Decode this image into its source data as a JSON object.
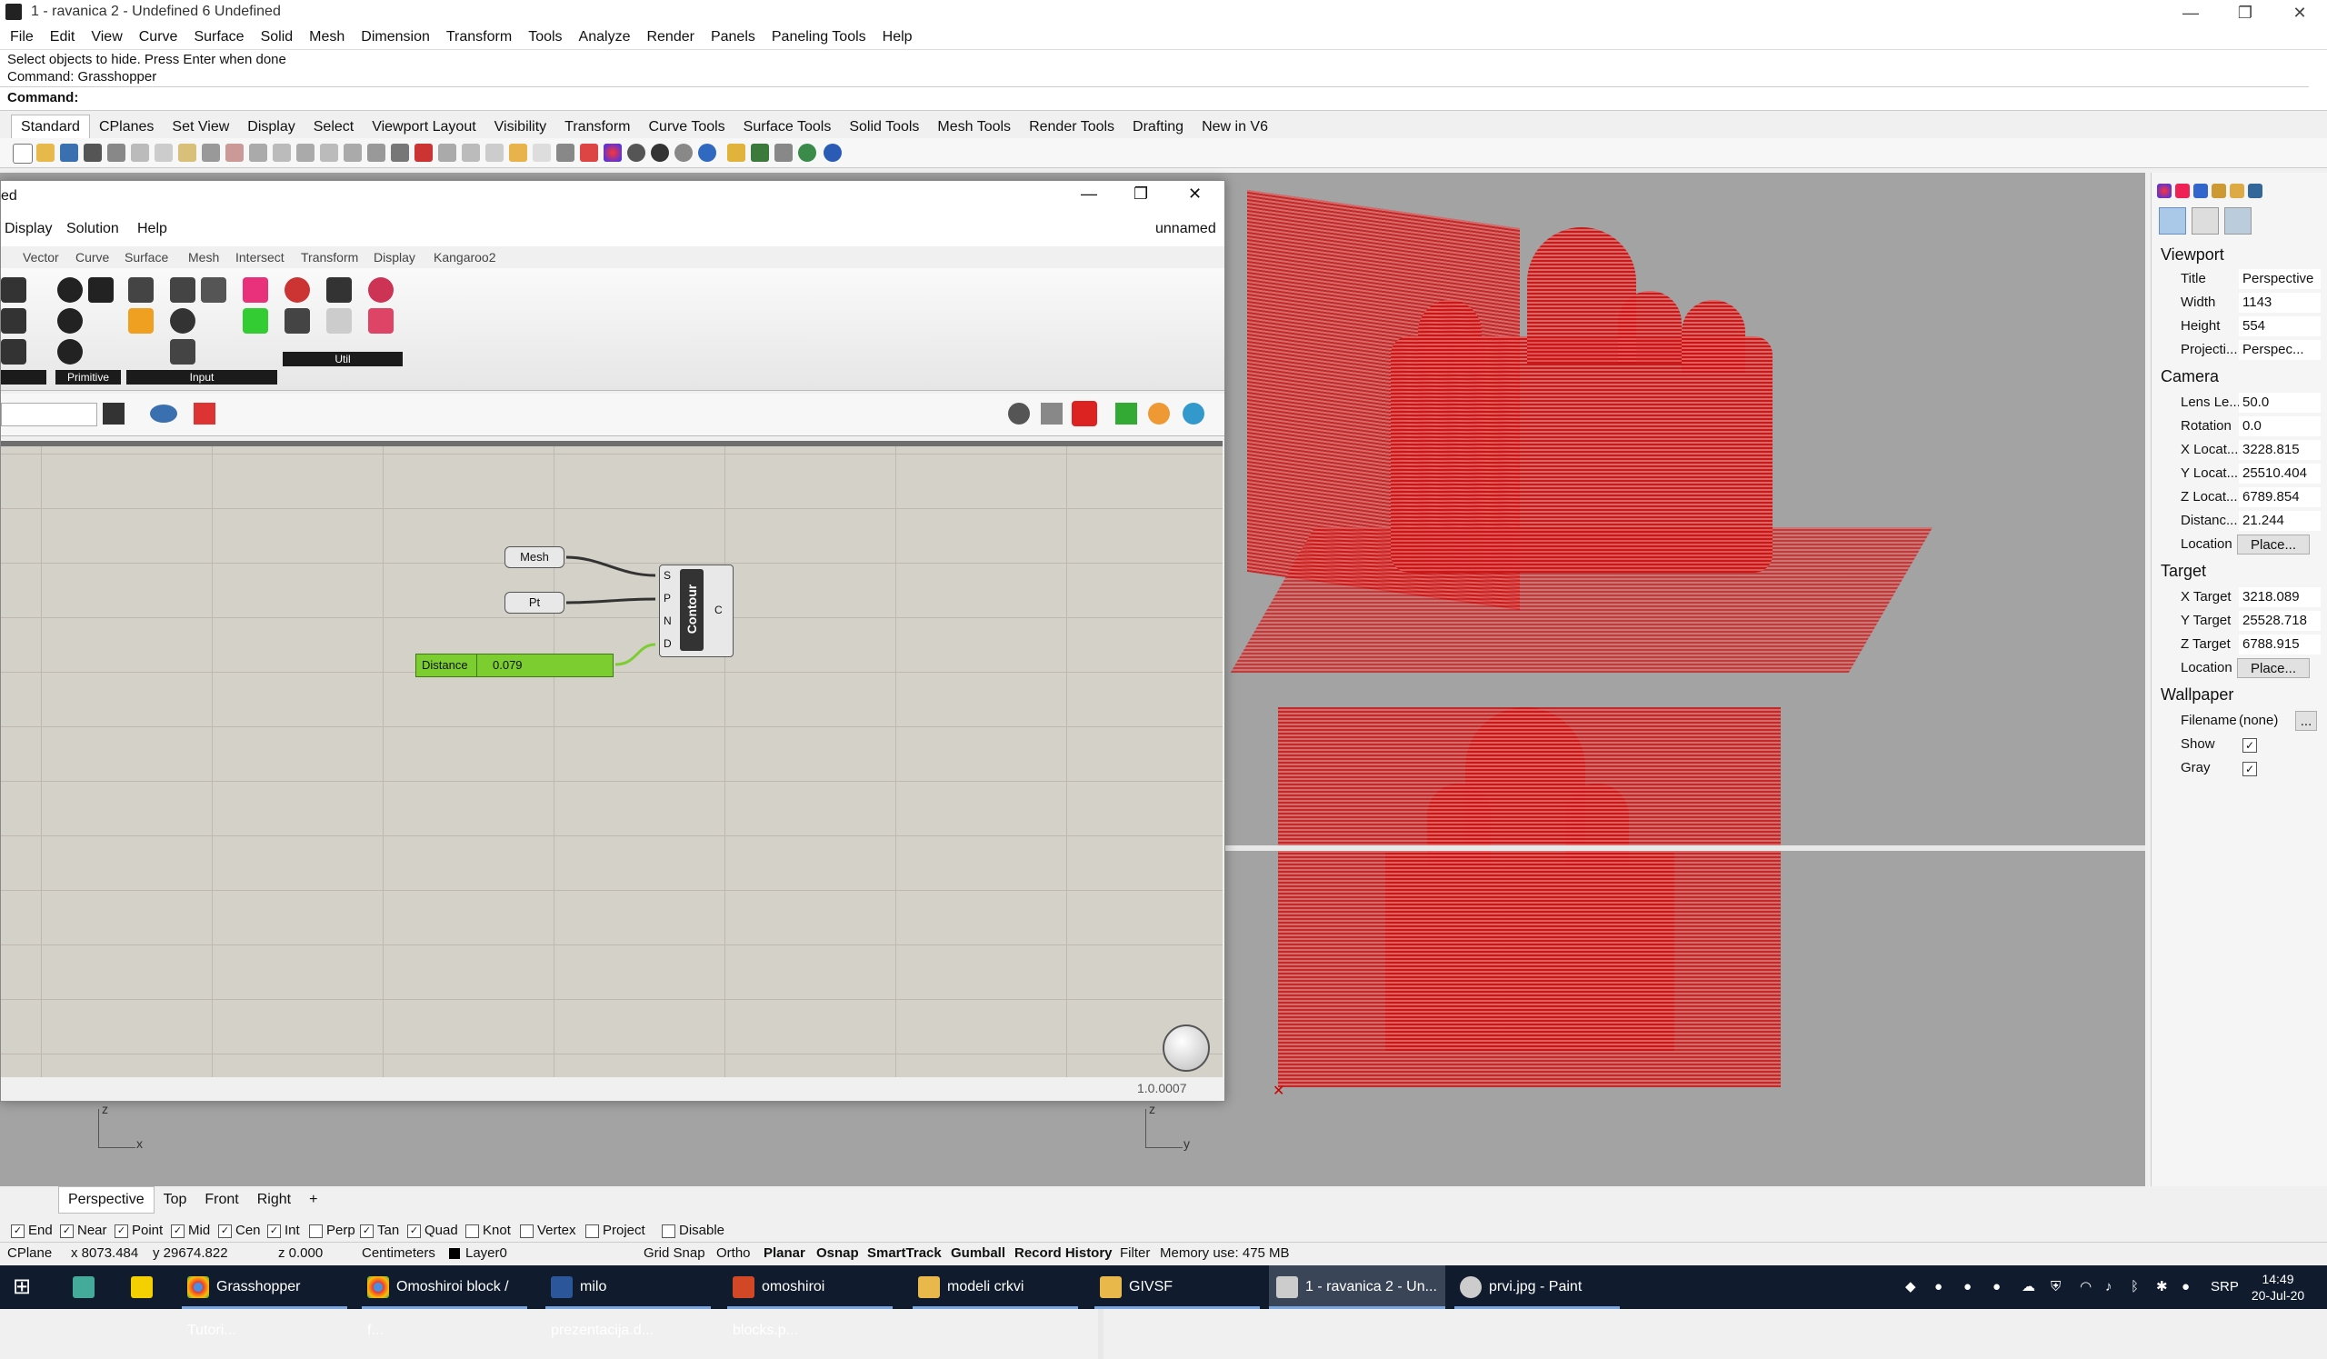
{
  "window": {
    "title": "1 - ravanica 2 - Undefined 6 Undefined",
    "controls": [
      "—",
      "❐",
      "✕"
    ]
  },
  "menubar": [
    "File",
    "Edit",
    "View",
    "Curve",
    "Surface",
    "Solid",
    "Mesh",
    "Dimension",
    "Transform",
    "Tools",
    "Analyze",
    "Render",
    "Panels",
    "Paneling Tools",
    "Help"
  ],
  "command": {
    "history1": "Select objects to hide. Press Enter when done",
    "history2": "Command: Grasshopper",
    "prompt": "Command:"
  },
  "toolbar_tabs": [
    "Standard",
    "CPlanes",
    "Set View",
    "Display",
    "Select",
    "Viewport Layout",
    "Visibility",
    "Transform",
    "Curve Tools",
    "Surface Tools",
    "Solid Tools",
    "Mesh Tools",
    "Render Tools",
    "Drafting",
    "New in V6"
  ],
  "grasshopper": {
    "title": "ed",
    "menu": [
      "Display",
      "Solution",
      "Help"
    ],
    "doc_name": "unnamed",
    "tabs": [
      "Vector",
      "Curve",
      "Surface",
      "Mesh",
      "Intersect",
      "Transform",
      "Display",
      "Kangaroo2"
    ],
    "groups": [
      "Primitive",
      "Input",
      "Util"
    ],
    "version": "1.0.0007",
    "components": {
      "mesh_param": "Mesh",
      "pt_param": "Pt",
      "slider_name": "Distance",
      "slider_value": "0.079",
      "contour_name": "Contour",
      "inputs": [
        "S",
        "P",
        "N",
        "D"
      ],
      "output": "C"
    }
  },
  "properties": {
    "viewport_header": "Viewport",
    "title_label": "Title",
    "title_value": "Perspective",
    "width_label": "Width",
    "width_value": "1143",
    "height_label": "Height",
    "height_value": "554",
    "projection_label": "Projecti...",
    "projection_value": "Perspec...",
    "camera_header": "Camera",
    "lens_label": "Lens Le...",
    "lens_value": "50.0",
    "rotation_label": "Rotation",
    "rotation_value": "0.0",
    "xloc_label": "X Locat...",
    "xloc_value": "3228.815",
    "yloc_label": "Y Locat...",
    "yloc_value": "25510.404",
    "zloc_label": "Z Locat...",
    "zloc_value": "6789.854",
    "dist_label": "Distanc...",
    "dist_value": "21.244",
    "location_label": "Location",
    "place_button": "Place...",
    "target_header": "Target",
    "xt_label": "X Target",
    "xt_value": "3218.089",
    "yt_label": "Y Target",
    "yt_value": "25528.718",
    "zt_label": "Z Target",
    "zt_value": "6788.915",
    "tloc_label": "Location",
    "tplace_button": "Place...",
    "wallpaper_header": "Wallpaper",
    "filename_label": "Filename",
    "filename_value": "(none)",
    "browse": "...",
    "show_label": "Show",
    "gray_label": "Gray"
  },
  "viewport_tabs": [
    "Perspective",
    "Top",
    "Front",
    "Right",
    "+"
  ],
  "osnaps": [
    {
      "label": "End",
      "checked": true
    },
    {
      "label": "Near",
      "checked": true
    },
    {
      "label": "Point",
      "checked": true
    },
    {
      "label": "Mid",
      "checked": true
    },
    {
      "label": "Cen",
      "checked": true
    },
    {
      "label": "Int",
      "checked": true
    },
    {
      "label": "Perp",
      "checked": false
    },
    {
      "label": "Tan",
      "checked": true
    },
    {
      "label": "Quad",
      "checked": true
    },
    {
      "label": "Knot",
      "checked": false
    },
    {
      "label": "Vertex",
      "checked": false
    },
    {
      "label": "Project",
      "checked": false
    },
    {
      "label": "Disable",
      "checked": false
    }
  ],
  "status": {
    "cplane": "CPlane",
    "x": "x 8073.484",
    "y": "y 29674.822",
    "z": "z 0.000",
    "units": "Centimeters",
    "layer": "Layer0",
    "grid_snap": "Grid Snap",
    "ortho": "Ortho",
    "planar": "Planar",
    "osnap": "Osnap",
    "smarttrack": "SmartTrack",
    "gumball": "Gumball",
    "record": "Record History",
    "filter": "Filter",
    "memory": "Memory use: 475 MB"
  },
  "axes": {
    "x": "x",
    "y": "y",
    "z": "z"
  },
  "taskbar": {
    "items": [
      "Grasshopper Tutori...",
      "Omoshiroi block / f...",
      "milo prezentacija.d...",
      "omoshiroi blocks.p...",
      "modeli crkvi",
      "GIVSF",
      "1 - ravanica 2 - Un...",
      "prvi.jpg - Paint"
    ],
    "lang": "SRP",
    "time": "14:49",
    "date": "20-Jul-20"
  },
  "colors": {
    "model_red": "#c81414",
    "gh_green": "#7ccd2f",
    "taskbar": "#101c2e"
  }
}
